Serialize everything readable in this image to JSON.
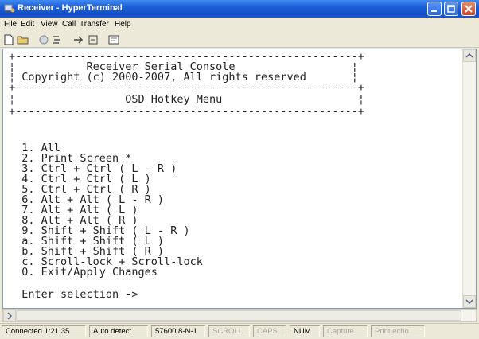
{
  "window": {
    "title": "Receiver - HyperTerminal"
  },
  "menu": [
    "File",
    "Edit",
    "View",
    "Call",
    "Transfer",
    "Help"
  ],
  "terminal": {
    "lines": [
      "+-----------------------------------------------------+",
      "¦           Receiver Serial Console                  ¦",
      "¦ Copyright (c) 2000-2007, All rights reserved       ¦",
      "+-----------------------------------------------------+",
      "¦                 OSD Hotkey Menu                     ¦",
      "+-----------------------------------------------------+",
      "",
      "",
      "  1. All",
      "  2. Print Screen *",
      "  3. Ctrl + Ctrl ( L - R )",
      "  4. Ctrl + Ctrl ( L )",
      "  5. Ctrl + Ctrl ( R )",
      "  6. Alt + Alt ( L - R )",
      "  7. Alt + Alt ( L )",
      "  8. Alt + Alt ( R )",
      "  9. Shift + Shift ( L - R )",
      "  a. Shift + Shift ( L )",
      "  b. Shift + Shift ( R )",
      "  c. Scroll-lock + Scroll-lock",
      "  0. Exit/Apply Changes",
      "",
      "  Enter selection ->"
    ]
  },
  "status": {
    "connected": "Connected 1:21:35",
    "detect": "Auto detect",
    "settings": "57600 8-N-1",
    "scroll": "SCROLL",
    "caps": "CAPS",
    "num": "NUM",
    "capture": "Capture",
    "print_echo": "Print echo"
  }
}
